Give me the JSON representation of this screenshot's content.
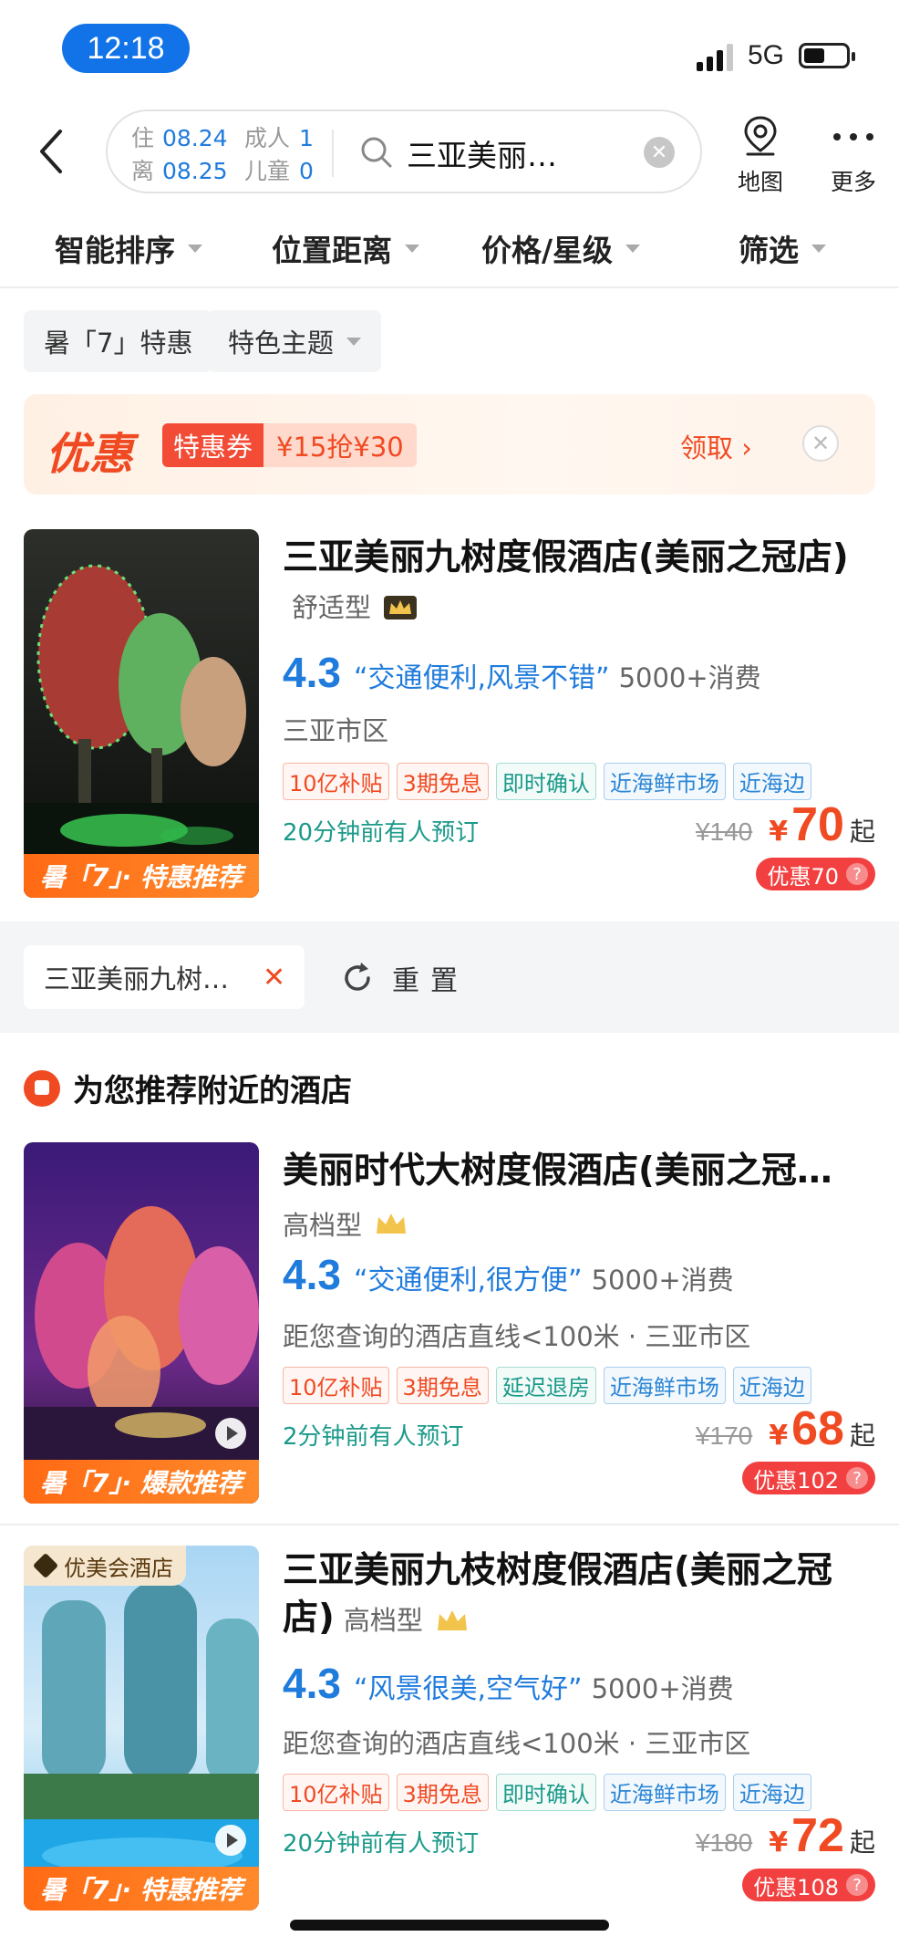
{
  "status": {
    "time": "12:18",
    "network": "5G"
  },
  "header": {
    "checkin_label": "住",
    "checkin_date": "08.24",
    "checkout_label": "离",
    "checkout_date": "08.25",
    "adult_label": "成人",
    "adult_count": "1",
    "child_label": "儿童",
    "child_count": "0",
    "query": "三亚美丽九树…",
    "map_label": "地图",
    "more_label": "更多"
  },
  "filters": [
    "智能排序",
    "位置距离",
    "价格/星级",
    "筛选"
  ],
  "chips": [
    "暑「7」特惠",
    "特色主题"
  ],
  "promo": {
    "title": "优惠",
    "coupon_type": "特惠券",
    "coupon_value": "¥15抢¥30",
    "get_label": "领取 ›"
  },
  "hotels": [
    {
      "name": "三亚美丽九树度假酒店(美丽之冠店)",
      "grade": "舒适型",
      "score": "4.3",
      "quote": "“交通便利,风景不错”",
      "consume": "5000+消费",
      "location": "三亚市区",
      "tags": [
        "10亿补贴",
        "3期免息",
        "即时确认",
        "近海鲜市场",
        "近海边"
      ],
      "booked": "20分钟前有人预订",
      "orig_price": "¥140",
      "price": "70",
      "discount": "优惠70",
      "band": "暑「7」· 特惠推荐"
    },
    {
      "name": "美丽时代大树度假酒店(美丽之冠…",
      "grade": "高档型",
      "score": "4.3",
      "quote": "“交通便利,很方便”",
      "consume": "5000+消费",
      "location": "距您查询的酒店直线<100米 · 三亚市区",
      "tags": [
        "10亿补贴",
        "3期免息",
        "延迟退房",
        "近海鲜市场",
        "近海边"
      ],
      "booked": "2分钟前有人预订",
      "orig_price": "¥170",
      "price": "68",
      "discount": "优惠102",
      "band": "暑「7」· 爆款推荐"
    },
    {
      "name": "三亚美丽九枝树度假酒店(美丽之冠店)",
      "grade": "高档型",
      "score": "4.3",
      "quote": "“风景很美,空气好”",
      "consume": "5000+消费",
      "location": "距您查询的酒店直线<100米 · 三亚市区",
      "tags": [
        "10亿补贴",
        "3期免息",
        "即时确认",
        "近海鲜市场",
        "近海边"
      ],
      "booked": "20分钟前有人预订",
      "orig_price": "¥180",
      "price": "72",
      "discount": "优惠108",
      "band": "暑「7」· 特惠推荐",
      "vip": "优美会酒店"
    }
  ],
  "common": {
    "yen": "¥",
    "qi": "起",
    "help": "?"
  },
  "query_bar": {
    "chip": "三亚美丽九树…",
    "reset": "重置"
  },
  "recommend_title": "为您推荐附近的酒店",
  "colors": {
    "accent_blue": "#1f7bdc",
    "price_red": "#f04a23",
    "booked_teal": "#1b9a8a"
  }
}
